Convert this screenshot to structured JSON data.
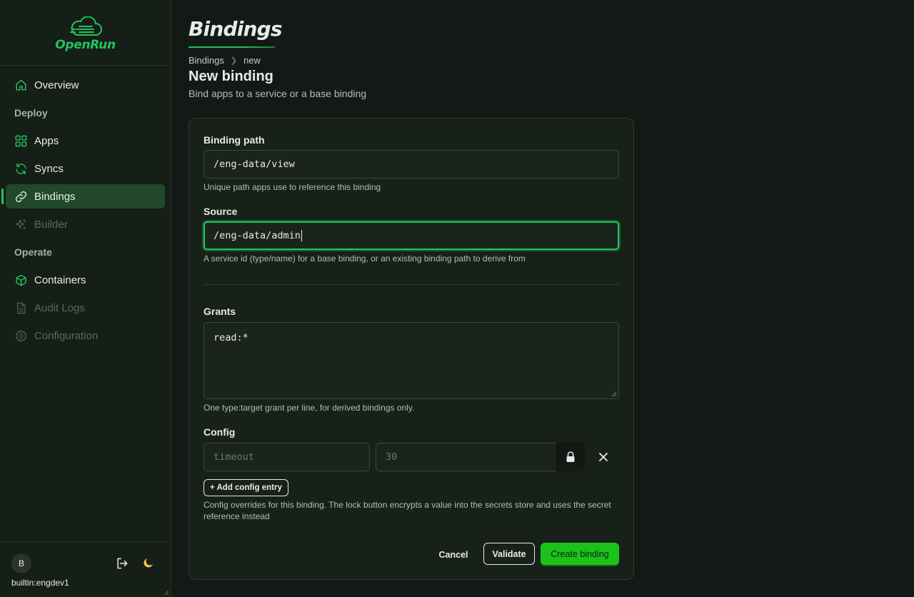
{
  "app": {
    "name": "OpenRun"
  },
  "sidebar": {
    "items": [
      {
        "label": "Overview",
        "icon": "home-icon",
        "state": "normal"
      },
      {
        "section": "Deploy"
      },
      {
        "label": "Apps",
        "icon": "grid-icon",
        "state": "normal"
      },
      {
        "label": "Syncs",
        "icon": "refresh-icon",
        "state": "normal"
      },
      {
        "label": "Bindings",
        "icon": "link-icon",
        "state": "active"
      },
      {
        "label": "Builder",
        "icon": "sparkle-icon",
        "state": "disabled"
      },
      {
        "section": "Operate"
      },
      {
        "label": "Containers",
        "icon": "cube-icon",
        "state": "normal"
      },
      {
        "label": "Audit Logs",
        "icon": "document-icon",
        "state": "disabled"
      },
      {
        "label": "Configuration",
        "icon": "gear-icon",
        "state": "disabled"
      }
    ],
    "user": {
      "avatar_letter": "B",
      "name": "builtin:engdev1"
    }
  },
  "page": {
    "heading": "Bindings",
    "breadcrumb": [
      "Bindings",
      "new"
    ],
    "title": "New binding",
    "subtitle": "Bind apps to a service or a base binding"
  },
  "form": {
    "binding_path": {
      "label": "Binding path",
      "value": "/eng-data/view",
      "hint": "Unique path apps use to reference this binding"
    },
    "source": {
      "label": "Source",
      "value": "/eng-data/admin",
      "hint": "A service id (type/name) for a base binding, or an existing binding path to derive from"
    },
    "grants": {
      "label": "Grants",
      "value": "read:*",
      "hint": "One type:target grant per line, for derived bindings only."
    },
    "config": {
      "label": "Config",
      "key_placeholder": "timeout",
      "value_placeholder": "30",
      "add_label": "+ Add config entry",
      "hint": "Config overrides for this binding. The lock button encrypts a value into the secrets store and uses the secret reference instead"
    },
    "actions": {
      "cancel": "Cancel",
      "validate": "Validate",
      "create": "Create binding"
    }
  },
  "colors": {
    "accent": "#22c55e",
    "primary_button": "#1cc21c",
    "background": "#131a15",
    "sidebar": "#161e18",
    "card": "#18201a"
  }
}
